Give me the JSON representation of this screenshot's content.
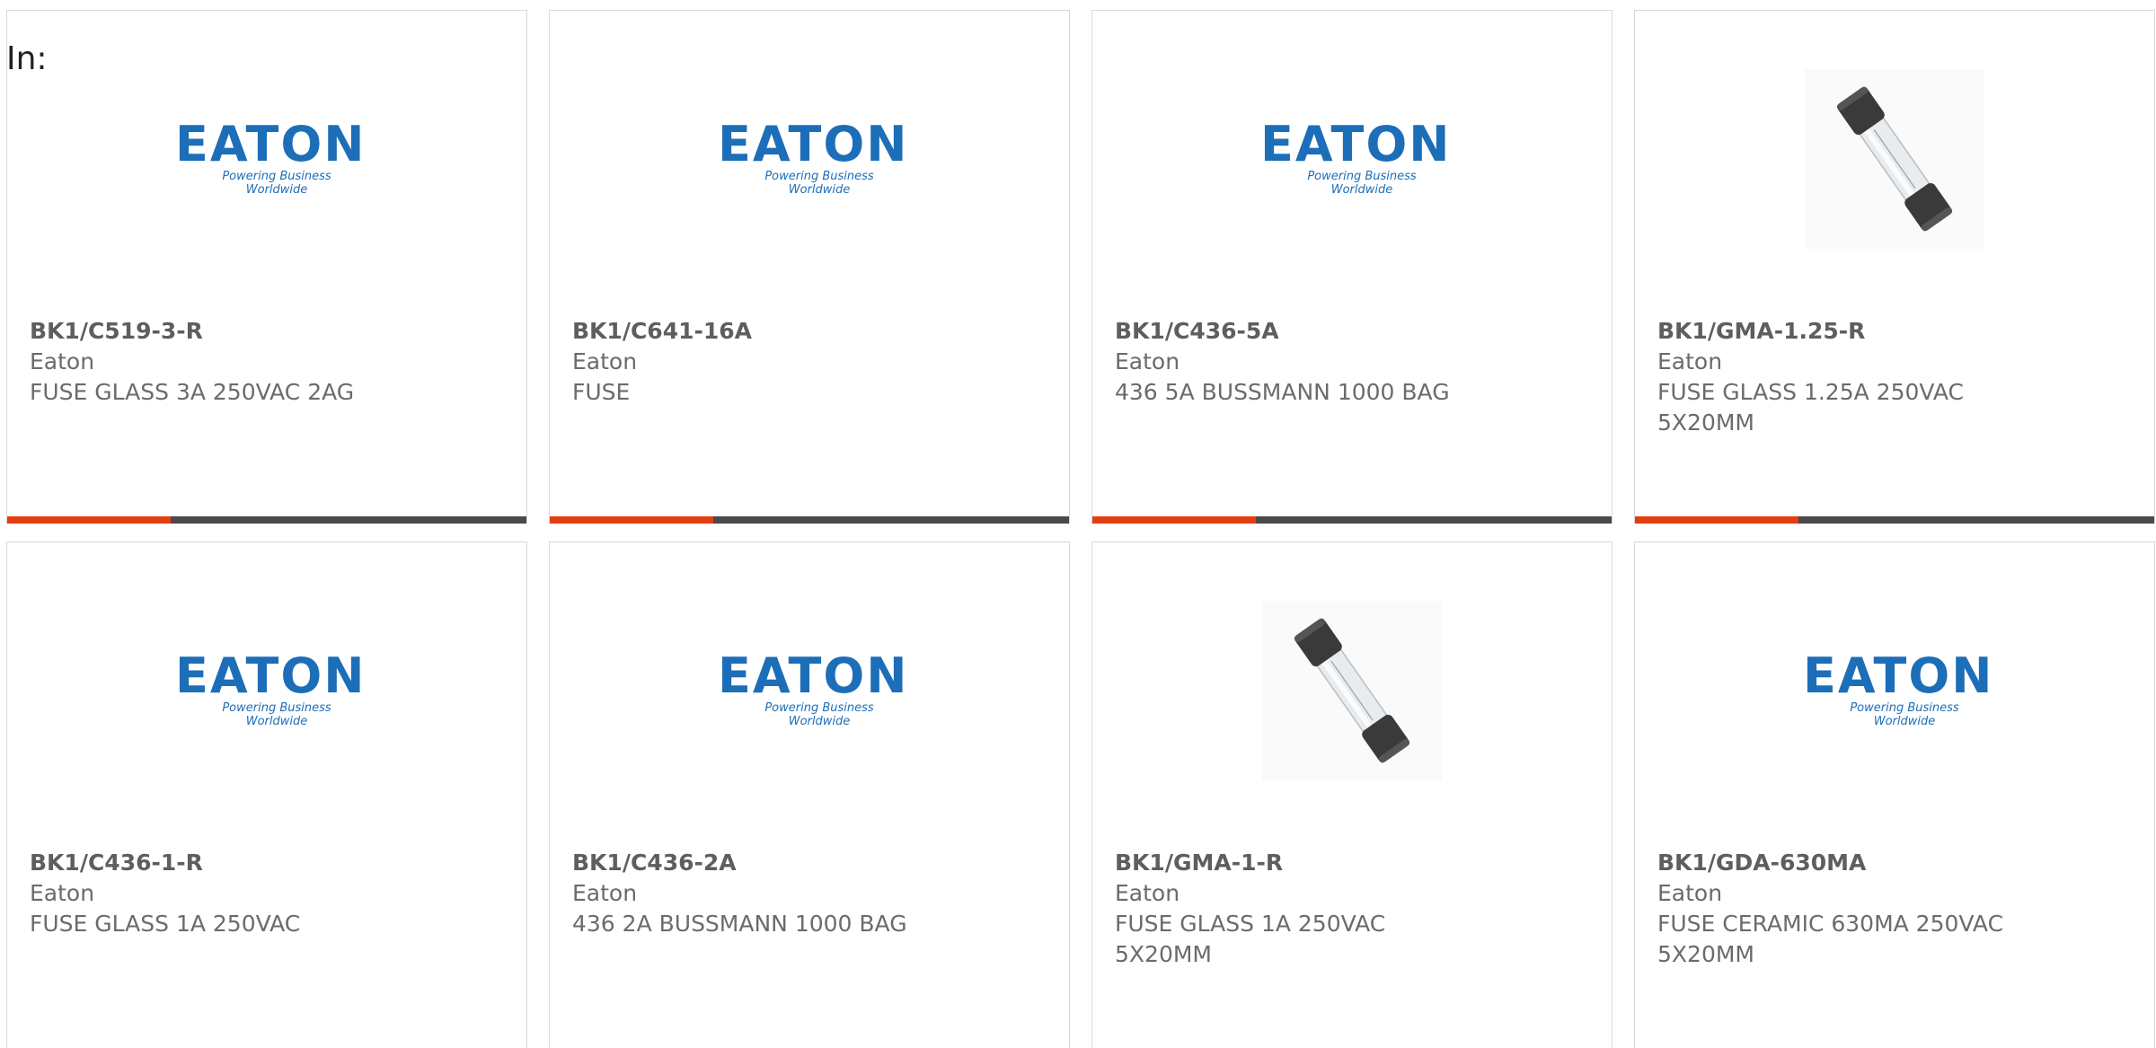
{
  "filter_label": "In:",
  "logo": {
    "brand": "EATON",
    "tagline": "Powering Business Worldwide"
  },
  "colors": {
    "accent_bar": "#e23e11",
    "bar": "#4a4a4a",
    "logo_blue": "#1c6eb8"
  },
  "products": [
    {
      "part_number": "BK1/C519-3-R",
      "manufacturer": "Eaton",
      "description": "FUSE GLASS 3A 250VAC 2AG",
      "image": "eaton-logo"
    },
    {
      "part_number": "BK1/C641-16A",
      "manufacturer": "Eaton",
      "description": "FUSE",
      "image": "eaton-logo"
    },
    {
      "part_number": "BK1/C436-5A",
      "manufacturer": "Eaton",
      "description": "436 5A BUSSMANN 1000 BAG",
      "image": "eaton-logo"
    },
    {
      "part_number": "BK1/GMA-1.25-R",
      "manufacturer": "Eaton",
      "description": "FUSE GLASS 1.25A 250VAC 5X20MM",
      "image": "glass-fuse"
    },
    {
      "part_number": "BK1/C436-1-R",
      "manufacturer": "Eaton",
      "description": "FUSE GLASS 1A 250VAC",
      "image": "eaton-logo"
    },
    {
      "part_number": "BK1/C436-2A",
      "manufacturer": "Eaton",
      "description": "436 2A BUSSMANN 1000 BAG",
      "image": "eaton-logo"
    },
    {
      "part_number": "BK1/GMA-1-R",
      "manufacturer": "Eaton",
      "description": "FUSE GLASS 1A 250VAC 5X20MM",
      "image": "glass-fuse"
    },
    {
      "part_number": "BK1/GDA-630MA",
      "manufacturer": "Eaton",
      "description": "FUSE CERAMIC 630MA 250VAC 5X20MM",
      "image": "eaton-logo"
    }
  ]
}
